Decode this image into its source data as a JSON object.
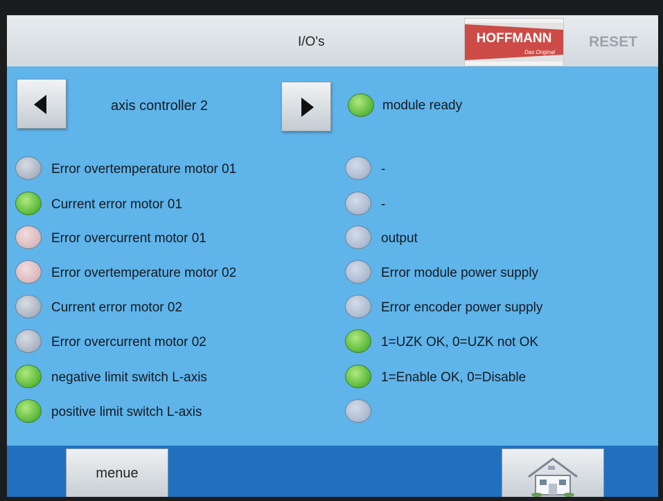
{
  "header": {
    "title": "I/O's",
    "logo_text": "HOFFMANN",
    "logo_sub": "Das Original",
    "reset_label": "RESET"
  },
  "nav": {
    "controller_label": "axis controller 2"
  },
  "status": {
    "module_ready_label": "module ready",
    "module_ready_state": "green"
  },
  "left_signals": [
    {
      "label": "Error overtemperature motor 01",
      "state": "grey"
    },
    {
      "label": "Current error motor 01",
      "state": "green"
    },
    {
      "label": "Error overcurrent motor 01",
      "state": "pink"
    },
    {
      "label": "Error overtemperature motor 02",
      "state": "pink"
    },
    {
      "label": "Current error motor 02",
      "state": "grey"
    },
    {
      "label": "Error overcurrent motor 02",
      "state": "grey"
    },
    {
      "label": "negative limit switch L-axis",
      "state": "green"
    },
    {
      "label": "positive limit switch L-axis",
      "state": "green"
    }
  ],
  "right_signals": [
    {
      "label": "-",
      "state": "blue"
    },
    {
      "label": "-",
      "state": "blue"
    },
    {
      "label": "output",
      "state": "blue"
    },
    {
      "label": "Error module power supply",
      "state": "blue"
    },
    {
      "label": "Error encoder power supply",
      "state": "blue"
    },
    {
      "label": "1=UZK OK, 0=UZK not OK",
      "state": "green"
    },
    {
      "label": "1=Enable OK, 0=Disable",
      "state": "green"
    },
    {
      "label": "",
      "state": "blue"
    }
  ],
  "footer": {
    "menue_label": "menue"
  },
  "colors": {
    "screen_bg": "#5fb4ea",
    "footer_bg": "#2170c0",
    "led_green": "#5dbb3c",
    "led_grey": "#a9b2c0",
    "led_pink": "#d8b7bc",
    "logo_red": "#cc4b46"
  }
}
